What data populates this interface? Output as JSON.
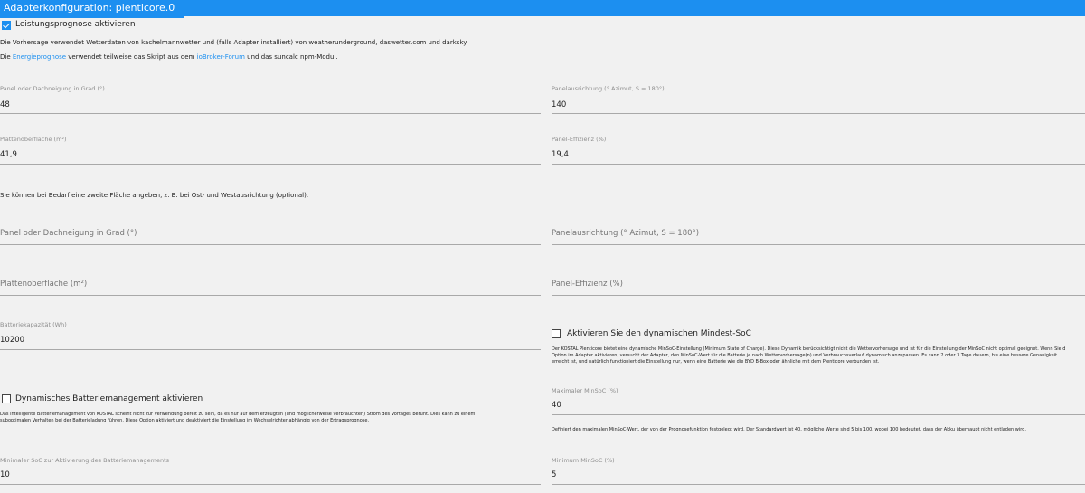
{
  "window": {
    "title": "Adapterkonfiguration: plenticore.0"
  },
  "forecast": {
    "enable_label": "Leistungsprognose aktivieren",
    "enable_checked": true,
    "description": "Die Vorhersage verwendet Wetterdaten von kachelmannwetter und (falls Adapter installiert) von weatherunderground, daswetter.com und darksky.",
    "usage_pre": "Die ",
    "energieprognose_link": "Energieprognose",
    "usage_mid": " verwendet teilweise das Skript aus dem ",
    "forum_link": "ioBroker-Forum",
    "usage_post": " und das suncalc npm-Modul."
  },
  "panel1": {
    "tilt": {
      "label": "Panel oder Dachneigung in Grad (°)",
      "value": "48"
    },
    "azimuth": {
      "label": "Panelausrichtung (° Azimut, S = 180°)",
      "value": "140"
    },
    "area": {
      "label": "Plattenoberfläche (m²)",
      "value": "41,9"
    },
    "efficiency": {
      "label": "Panel-Effizienz (%)",
      "value": "19,4"
    }
  },
  "second_area_note": "Sie können bei Bedarf eine zweite Fläche angeben, z. B. bei Ost- und Westausrichtung (optional).",
  "panel2": {
    "tilt": {
      "label": "Panel oder Dachneigung in Grad (°)",
      "value": ""
    },
    "azimuth": {
      "label": "Panelausrichtung (° Azimut, S = 180°)",
      "value": ""
    },
    "area": {
      "label": "Plattenoberfläche (m²)",
      "value": ""
    },
    "efficiency": {
      "label": "Panel-Effizienz (%)",
      "value": ""
    }
  },
  "battery": {
    "capacity": {
      "label": "Batteriekapazität (Wh)",
      "value": "10200"
    }
  },
  "dynamic_minsoc": {
    "enable_label": "Aktivieren Sie den dynamischen Mindest-SoC",
    "enable_checked": false,
    "description_line1": "Der KOSTAL Plenticore bietet eine dynamische MinSoC-Einstellung (Minimum State of Charge). Diese Dynamik berücksichtigt nicht die Wettervorhersage und ist für die Einstellung der MinSoC nicht optimal geeignet. Wenn Sie d",
    "description_line2": "Option im Adapter aktivieren, versucht der Adapter, den MinSoC-Wert für die Batterie je nach Wettervorhersage(n) und Verbrauchsverlauf dynamisch anzupassen. Es kann 2 oder 3 Tage dauern, bis eine bessere Genauigkeit",
    "description_line3": "erreicht ist, und natürlich funktioniert die Einstellung nur, wenn eine Batterie wie die BYD B-Box oder ähnliche mit dem Plenticore verbunden ist.",
    "max": {
      "label": "Maximaler MinSoC (%)",
      "value": "40",
      "help": "Definiert den maximalen MinSoC-Wert, der von der Prognosefunktion festgelegt wird. Der Standardwert ist 40, mögliche Werte sind 5 bis 100, wobei 100 bedeutet, dass der Akku überhaupt nicht entladen wird."
    },
    "min": {
      "label": "Minimum MinSoC (%)",
      "value": "5"
    }
  },
  "battery_management": {
    "enable_label": "Dynamisches Batteriemanagement aktivieren",
    "enable_checked": false,
    "description_line1": "Das intelligente Batteriemanagement von KOSTAL scheint nicht zur Verwendung bereit zu sein, da es nur auf dem erzeugten (und möglicherweise verbrauchten) Strom des Vortages beruht. Dies kann zu einem",
    "description_line2": "suboptimalen Verhalten bei der Batterieladung führen. Diese Option aktiviert und deaktiviert die Einstellung im Wechselrichter abhängig von der Ertragsprognose.",
    "min_soc": {
      "label": "Minimaler SoC zur Aktivierung des Batteriemanagements",
      "value": "10"
    }
  }
}
